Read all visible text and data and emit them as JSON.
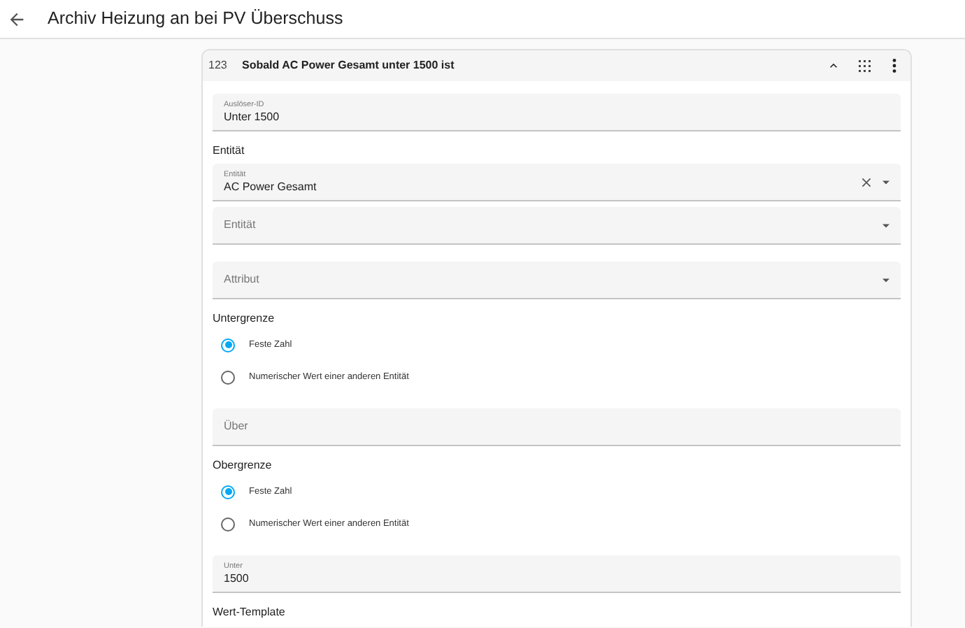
{
  "header": {
    "title": "Archiv Heizung an bei PV Überschuss"
  },
  "card": {
    "badge": "123",
    "title": "Sobald AC Power Gesamt unter 1500 ist",
    "expanded": true,
    "items": [
      {
        "kind": "field",
        "label": "Auslöser-ID",
        "value": "Unter 1500",
        "clearable": false,
        "dropdown": false
      },
      {
        "kind": "heading",
        "text": "Entität"
      },
      {
        "kind": "field",
        "label": "Entität",
        "value": "AC Power Gesamt",
        "clearable": true,
        "dropdown": true
      },
      {
        "kind": "field",
        "placeholder": "Entität",
        "clearable": false,
        "dropdown": true
      },
      {
        "kind": "gap"
      },
      {
        "kind": "field",
        "placeholder": "Attribut",
        "clearable": false,
        "dropdown": true
      },
      {
        "kind": "heading",
        "text": "Untergrenze"
      },
      {
        "kind": "radios",
        "options": [
          {
            "label": "Feste Zahl",
            "selected": true
          },
          {
            "label": "Numerischer Wert einer anderen Entität",
            "selected": false
          }
        ]
      },
      {
        "kind": "field",
        "placeholder": "Über",
        "clearable": false,
        "dropdown": false
      },
      {
        "kind": "heading",
        "text": "Obergrenze"
      },
      {
        "kind": "radios",
        "options": [
          {
            "label": "Feste Zahl",
            "selected": true
          },
          {
            "label": "Numerischer Wert einer anderen Entität",
            "selected": false
          }
        ]
      },
      {
        "kind": "field",
        "label": "Unter",
        "value": "1500",
        "clearable": false,
        "dropdown": false
      },
      {
        "kind": "heading",
        "text": "Wert-Template"
      }
    ]
  }
}
